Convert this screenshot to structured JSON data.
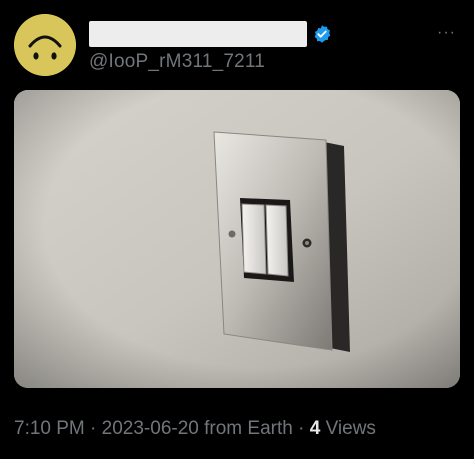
{
  "author": {
    "handle": "@IooP_rM311_7211",
    "avatar_icon": "upside-down-smiley-icon",
    "verified_icon": "verified-badge-icon",
    "verified_color": "#1d9bf0"
  },
  "header": {
    "more_icon": "more-options-icon",
    "more_glyph": "···"
  },
  "media": {
    "image_icon": "light-switch-photo"
  },
  "meta": {
    "time": "7:10 PM",
    "separator_1": " · ",
    "date": "2023-06-20",
    "from": " from Earth",
    "separator_2": " · ",
    "views_count": "4",
    "views_label": " Views"
  },
  "colors": {
    "background": "#000000",
    "muted_text": "#71767b",
    "primary_text": "#e7e9ea",
    "avatar": "#d8c65a"
  }
}
